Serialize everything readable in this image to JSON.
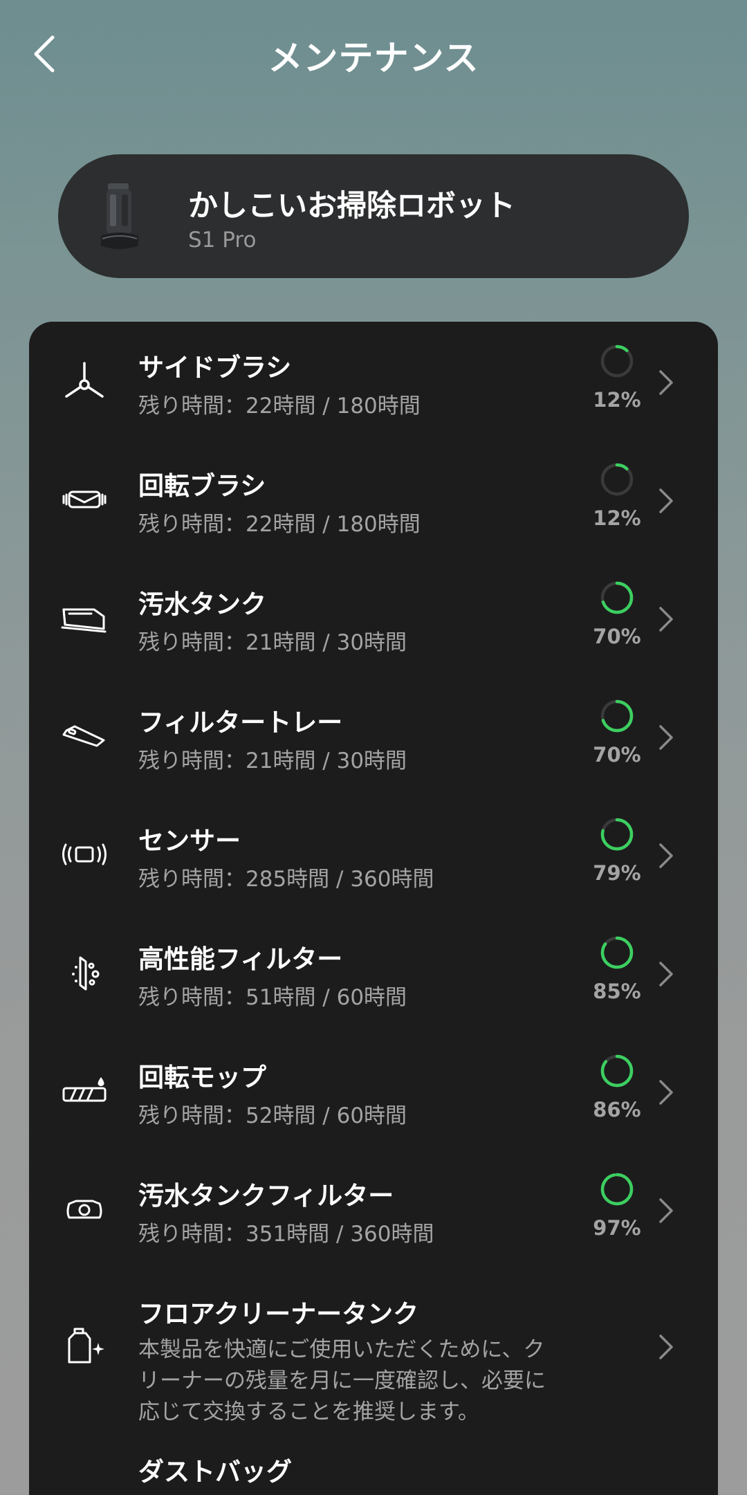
{
  "header": {
    "title": "メンテナンス"
  },
  "device": {
    "name": "かしこいお掃除ロボット",
    "model": "S1 Pro"
  },
  "items": [
    {
      "title": "サイドブラシ",
      "remaining": "残り時間：22時間 / 180時間",
      "percent_label": "12%",
      "percent": 12,
      "icon": "side-brush-icon"
    },
    {
      "title": "回転ブラシ",
      "remaining": "残り時間：22時間 / 180時間",
      "percent_label": "12%",
      "percent": 12,
      "icon": "roller-brush-icon"
    },
    {
      "title": "汚水タンク",
      "remaining": "残り時間：21時間 / 30時間",
      "percent_label": "70%",
      "percent": 70,
      "icon": "dirty-water-tank-icon"
    },
    {
      "title": "フィルタートレー",
      "remaining": "残り時間：21時間 / 30時間",
      "percent_label": "70%",
      "percent": 70,
      "icon": "filter-tray-icon"
    },
    {
      "title": "センサー",
      "remaining": "残り時間：285時間 / 360時間",
      "percent_label": "79%",
      "percent": 79,
      "icon": "sensor-icon"
    },
    {
      "title": "高性能フィルター",
      "remaining": "残り時間：51時間 / 60時間",
      "percent_label": "85%",
      "percent": 85,
      "icon": "hepa-filter-icon"
    },
    {
      "title": "回転モップ",
      "remaining": "残り時間：52時間 / 60時間",
      "percent_label": "86%",
      "percent": 86,
      "icon": "rotating-mop-icon"
    },
    {
      "title": "汚水タンクフィルター",
      "remaining": "残り時間：351時間 / 360時間",
      "percent_label": "97%",
      "percent": 97,
      "icon": "tank-filter-icon"
    }
  ],
  "floor_cleaner": {
    "title": "フロアクリーナータンク",
    "desc_lines": [
      "本製品を快適にご使用いただくために、ク",
      "リーナーの残量を月に一度確認し、必要に",
      "応じて交換することを推奨します。"
    ],
    "icon": "floor-cleaner-tank-icon"
  },
  "dust_bag": {
    "title": "ダストバッグ"
  },
  "colors": {
    "ring_fill": "#3ccf60",
    "ring_track": "#3a3a3a",
    "panel": "#1c1c1d",
    "card": "#2d2e2f"
  }
}
